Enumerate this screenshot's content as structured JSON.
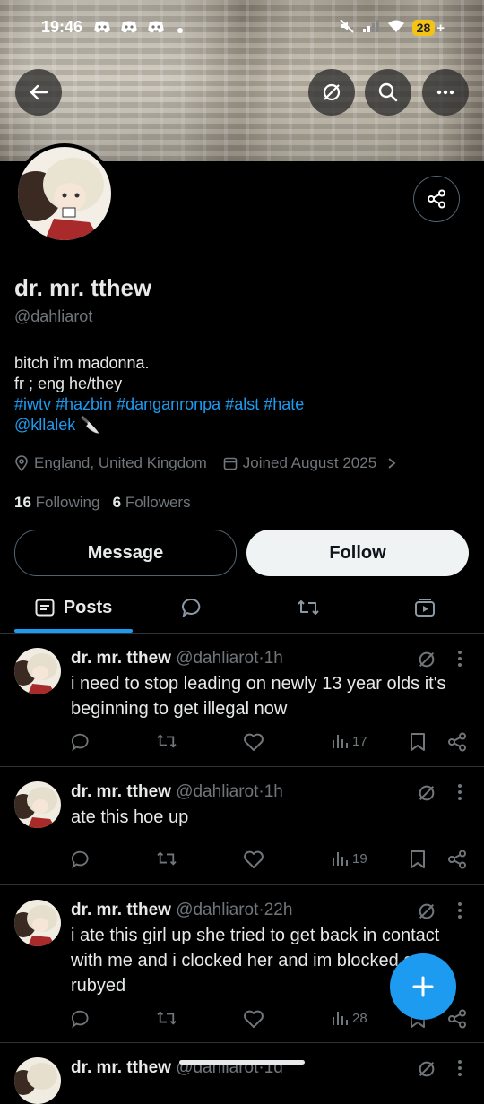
{
  "status_bar": {
    "time": "19:46",
    "battery": "28",
    "notif_icons": [
      "discord-icon",
      "discord-icon",
      "discord-icon"
    ]
  },
  "profile": {
    "name": "dr. mr. tthew",
    "handle": "@dahliarot",
    "bio_line1": "bitch i'm madonna.",
    "bio_line2": "fr ; eng he/they",
    "bio_hashtags": "#iwtv #hazbin #danganronpa #alst #hate",
    "bio_mention": "@kllalek",
    "bio_emoji": "🔪",
    "location": "England, United Kingdom",
    "joined": "Joined August 2025",
    "following_count": "16",
    "following_label": "Following",
    "followers_count": "6",
    "followers_label": "Followers",
    "message_label": "Message",
    "follow_label": "Follow"
  },
  "tabs": {
    "posts_label": "Posts"
  },
  "posts": [
    {
      "name": "dr. mr. tthew",
      "handle": "@dahliarot",
      "sep": "·",
      "time": "1h",
      "text": "i need to stop leading on newly 13 year olds it's beginning to get illegal now",
      "views": "17"
    },
    {
      "name": "dr. mr. tthew",
      "handle": "@dahliarot",
      "sep": "·",
      "time": "1h",
      "text": "ate this hoe up",
      "views": "19"
    },
    {
      "name": "dr. mr. tthew",
      "handle": "@dahliarot",
      "sep": "·",
      "time": "22h",
      "text": "i ate this girl up she tried to get back in contact with me and i clocked her and im blocked get rubyed",
      "views": "28"
    },
    {
      "name": "dr. mr. tthew",
      "handle": "@dahliarot",
      "sep": "·",
      "time": "1d",
      "text": "",
      "views": ""
    }
  ],
  "colors": {
    "accent": "#1d9bf0",
    "background": "#000000",
    "muted": "#71767b"
  }
}
